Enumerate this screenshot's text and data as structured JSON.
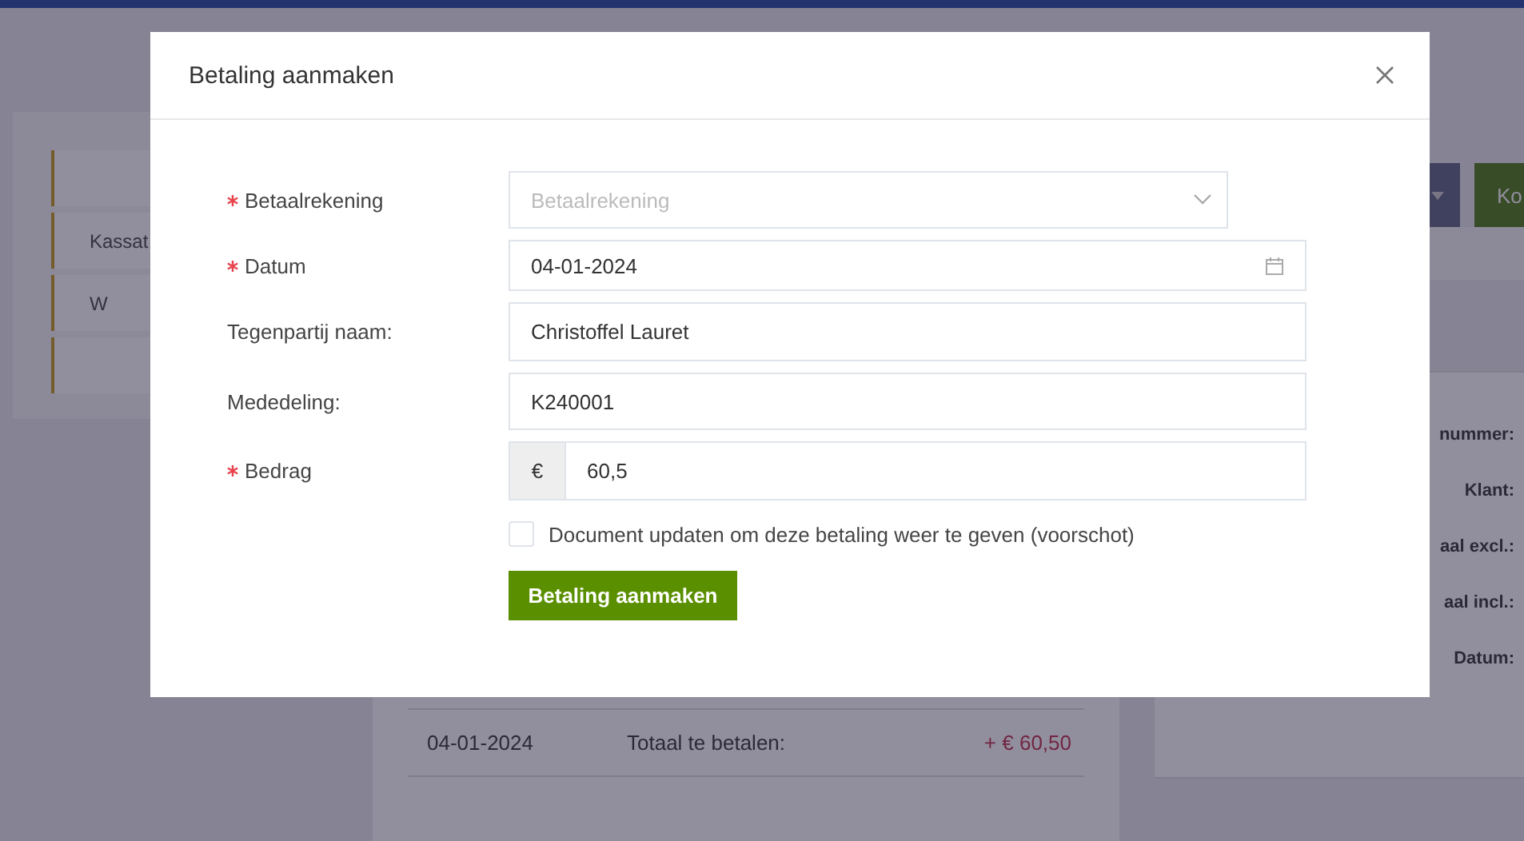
{
  "toolbar": {
    "buttons": [
      {
        "kind": "caret"
      },
      {
        "kind": "primary",
        "label": "Ko"
      }
    ]
  },
  "sidebar": {
    "items": [
      {
        "kind": "blank"
      },
      {
        "kind": "text",
        "label": "Kassat"
      },
      {
        "kind": "text",
        "label": "W"
      },
      {
        "kind": "blank"
      }
    ]
  },
  "details": {
    "labels": [
      "nummer:",
      "Klant:",
      "aal excl.:",
      "aal incl.:",
      "Datum:"
    ]
  },
  "payments": {
    "rows": [
      {
        "date": "04-01-2024",
        "description": "Totaal te betalen:",
        "amount": "+ € 60,50"
      }
    ]
  },
  "modal": {
    "title": "Betaling aanmaken",
    "fields": [
      {
        "kind": "select",
        "label": "Betaalrekening",
        "required": true,
        "placeholder": "Betaalrekening"
      },
      {
        "kind": "date",
        "label": "Datum",
        "required": true,
        "value": "04-01-2024"
      },
      {
        "kind": "text",
        "label": "Tegenpartij naam:",
        "required": false,
        "value": "Christoffel Lauret"
      },
      {
        "kind": "text",
        "label": "Mededeling:",
        "required": false,
        "value": "K240001"
      },
      {
        "kind": "currency",
        "label": "Bedrag",
        "required": true,
        "prefix": "€",
        "value": "60,5"
      }
    ],
    "checkbox": {
      "label": "Document updaten om deze betaling weer te geven (voorschot)",
      "checked": false
    },
    "submit": "Betaling aanmaken"
  }
}
